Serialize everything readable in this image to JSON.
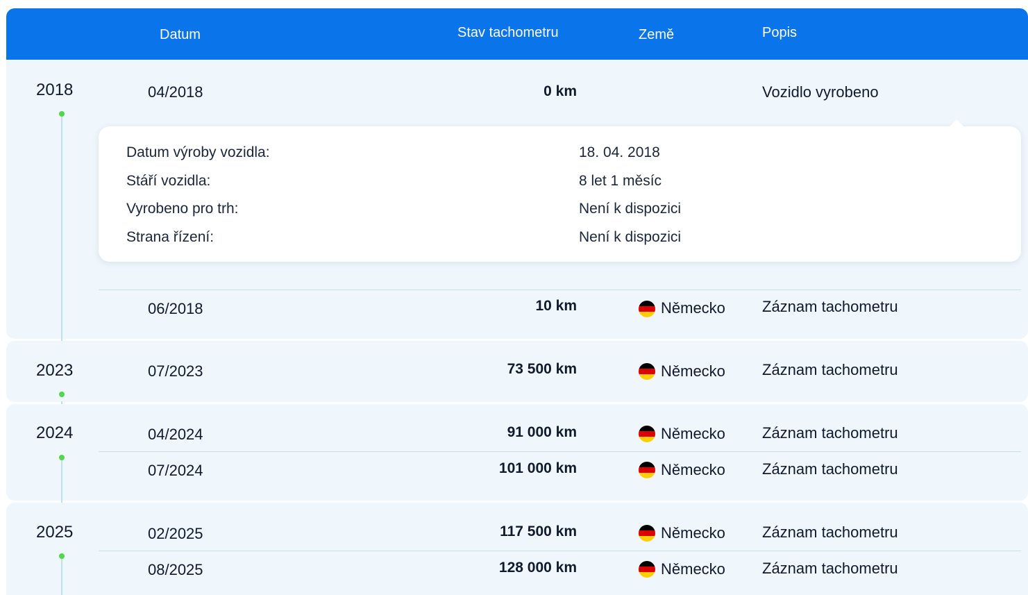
{
  "header": {
    "date": "Datum",
    "odometer": "Stav tachometru",
    "country": "Země",
    "description": "Popis"
  },
  "colors": {
    "header_bg": "#0a74ea",
    "row_bg": "#eff6fc",
    "timeline_dot": "#4fd84c"
  },
  "years": [
    {
      "year": "2018",
      "rows": [
        {
          "date": "04/2018",
          "km": "0 km",
          "country": "",
          "flag": "",
          "desc": "Vozidlo vyrobeno"
        },
        {
          "date": "06/2018",
          "km": "10 km",
          "country": "Německo",
          "flag": "germany-flag-icon",
          "desc": "Záznam tachometru"
        }
      ]
    },
    {
      "year": "2023",
      "rows": [
        {
          "date": "07/2023",
          "km": "73 500 km",
          "country": "Německo",
          "flag": "germany-flag-icon",
          "desc": "Záznam tachometru"
        }
      ]
    },
    {
      "year": "2024",
      "rows": [
        {
          "date": "04/2024",
          "km": "91 000 km",
          "country": "Německo",
          "flag": "germany-flag-icon",
          "desc": "Záznam tachometru"
        },
        {
          "date": "07/2024",
          "km": "101 000 km",
          "country": "Německo",
          "flag": "germany-flag-icon",
          "desc": "Záznam tachometru"
        }
      ]
    },
    {
      "year": "2025",
      "rows": [
        {
          "date": "02/2025",
          "km": "117 500 km",
          "country": "Německo",
          "flag": "germany-flag-icon",
          "desc": "Záznam tachometru"
        },
        {
          "date": "08/2025",
          "km": "128 000 km",
          "country": "Německo",
          "flag": "germany-flag-icon",
          "desc": "Záznam tachometru"
        }
      ]
    }
  ],
  "details": [
    {
      "label": "Datum výroby vozidla:",
      "value": "18. 04. 2018"
    },
    {
      "label": "Stáří vozidla:",
      "value": "8 let 1 měsíc"
    },
    {
      "label": "Vyrobeno pro trh:",
      "value": "Není k dispozici"
    },
    {
      "label": "Strana řízení:",
      "value": "Není k dispozici"
    }
  ]
}
